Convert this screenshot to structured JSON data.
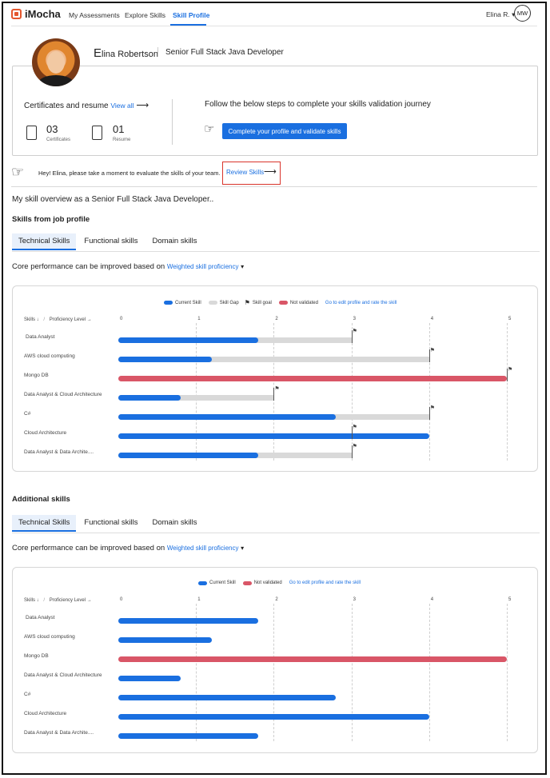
{
  "nav": {
    "logo_text": "iMocha",
    "links": [
      "My Assessments",
      "Explore Skills",
      "Skill Profile"
    ],
    "user": "Elina R. ▾",
    "initials": "MW"
  },
  "profile": {
    "initial_letter": "E",
    "name_rest": "lina Robertson",
    "role": "Senior Full Stack Java Developer"
  },
  "card": {
    "certs_title": "Certificates and resume",
    "view_all": "View all",
    "arrow": "⟶",
    "certificates_count": "03",
    "certificates_label": "Certificates",
    "resume_count": "01",
    "resume_label": "Resume",
    "steps_title": "Follow the below steps to complete your skills validation journey",
    "validate_button": "Complete your profile and validate skills"
  },
  "review": {
    "message": "Hey! Elina, please take a moment to evaluate the skills of your team.",
    "link": "Review Skills",
    "arrow": "⟶"
  },
  "overview": "My skill overview as a Senior  Full Stack Java Developer..",
  "colors": {
    "current": "#1a6fe0",
    "gap": "#d9d9d9",
    "not_validated": "#d95667"
  },
  "job_profile": {
    "title": "Skills  from job profile",
    "tabs": [
      "Technical Skills",
      "Functional skills",
      "Domain skills"
    ],
    "core_text": "Core performance can be improved based on",
    "weighted": "Weighted skill proficiency",
    "caret": "▾",
    "legend": {
      "current": "Current Skill",
      "gap": "Skill Gap",
      "goal": "Skill goal",
      "not_validated": "Not validated",
      "link": "Go to edit profile and rate the skill"
    },
    "skills_head": "Skills ↓",
    "prof_head": "Proficiency Level →"
  },
  "additional": {
    "title": "Additional skills",
    "tabs": [
      "Technical Skills",
      "Functional skills",
      "Domain skills"
    ],
    "core_text": "Core performance can be improved based on",
    "weighted": "Weighted skill proficiency",
    "caret": "▾",
    "legend": {
      "current": "Current Skill",
      "not_validated": "Not validated",
      "link": "Go to edit profile and rate the skill"
    },
    "skills_head": "Skills ↓",
    "prof_head": "Proficiency Level →"
  },
  "chart_data": [
    {
      "type": "bar",
      "orientation": "horizontal",
      "xlim": [
        0,
        5
      ],
      "x_ticks": [
        "0",
        "1",
        "2",
        "3",
        "4",
        "5"
      ],
      "categories": [
        "Data Analyst",
        "AWS cloud computing",
        "Mongo DB",
        "Data Analyst & Cloud Architecture",
        "C#",
        "Cloud Architecture",
        "Data Analyst & Data Archite...."
      ],
      "series": [
        {
          "name": "Current Skill",
          "values": [
            1.8,
            1.2,
            null,
            0.8,
            2.8,
            4.0,
            1.8
          ]
        },
        {
          "name": "Skill goal",
          "values": [
            3,
            4,
            5,
            2,
            4,
            3,
            3
          ]
        },
        {
          "name": "Not validated",
          "values": [
            null,
            null,
            5,
            null,
            null,
            null,
            null
          ]
        }
      ],
      "grid": true,
      "legend": "top-center"
    },
    {
      "type": "bar",
      "orientation": "horizontal",
      "xlim": [
        0,
        5
      ],
      "x_ticks": [
        "0",
        "1",
        "2",
        "3",
        "4",
        "5"
      ],
      "categories": [
        "Data Analyst",
        "AWS cloud computing",
        "Mongo DB",
        "Data Analyst & Cloud Architecture",
        "C#",
        "Cloud Architecture",
        "Data Analyst & Data Archite...."
      ],
      "series": [
        {
          "name": "Current Skill",
          "values": [
            1.8,
            1.2,
            null,
            0.8,
            2.8,
            4.0,
            1.8
          ]
        },
        {
          "name": "Not validated",
          "values": [
            null,
            null,
            5,
            null,
            null,
            null,
            null
          ]
        }
      ],
      "grid": true,
      "legend": "top-center"
    }
  ]
}
